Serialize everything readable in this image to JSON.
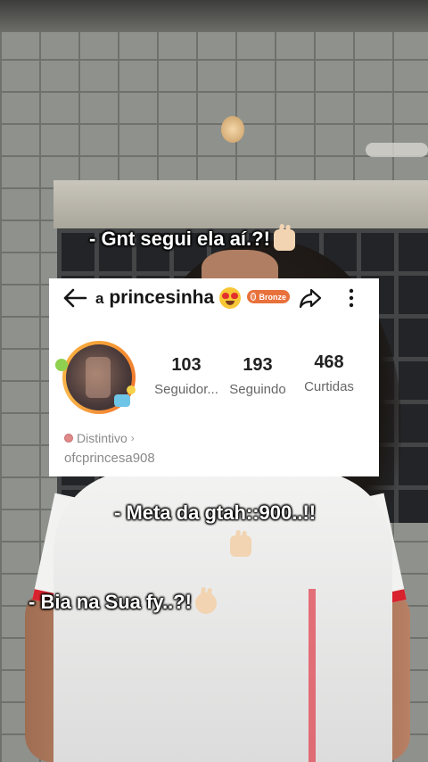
{
  "captions": {
    "line1": "- Gnt segui ela aí.?!",
    "line2": "- Meta da gtah::900..!!",
    "line3": "- Bia na Sua fy..?!"
  },
  "profile": {
    "username_prefix": "a",
    "username": "princesinha",
    "badge_label": "Bronze",
    "stats": [
      {
        "value": "103",
        "label": "Seguidor..."
      },
      {
        "value": "193",
        "label": "Seguindo"
      },
      {
        "value": "468",
        "label": "Curtidas"
      }
    ],
    "distintivo_label": "Distintivo",
    "handle": "ofcprincesa908"
  },
  "icons": {
    "back": "arrow-left-icon",
    "share": "share-icon",
    "more": "more-vertical-icon",
    "emoji_face": "heart-eyes-emoji-icon",
    "emoji_hand": "peace-hand-emoji-icon"
  },
  "colors": {
    "card_bg": "#ffffff",
    "badge": "#e8713c",
    "caption_text": "#ffffff",
    "shirt_trim": "#d8222e"
  }
}
